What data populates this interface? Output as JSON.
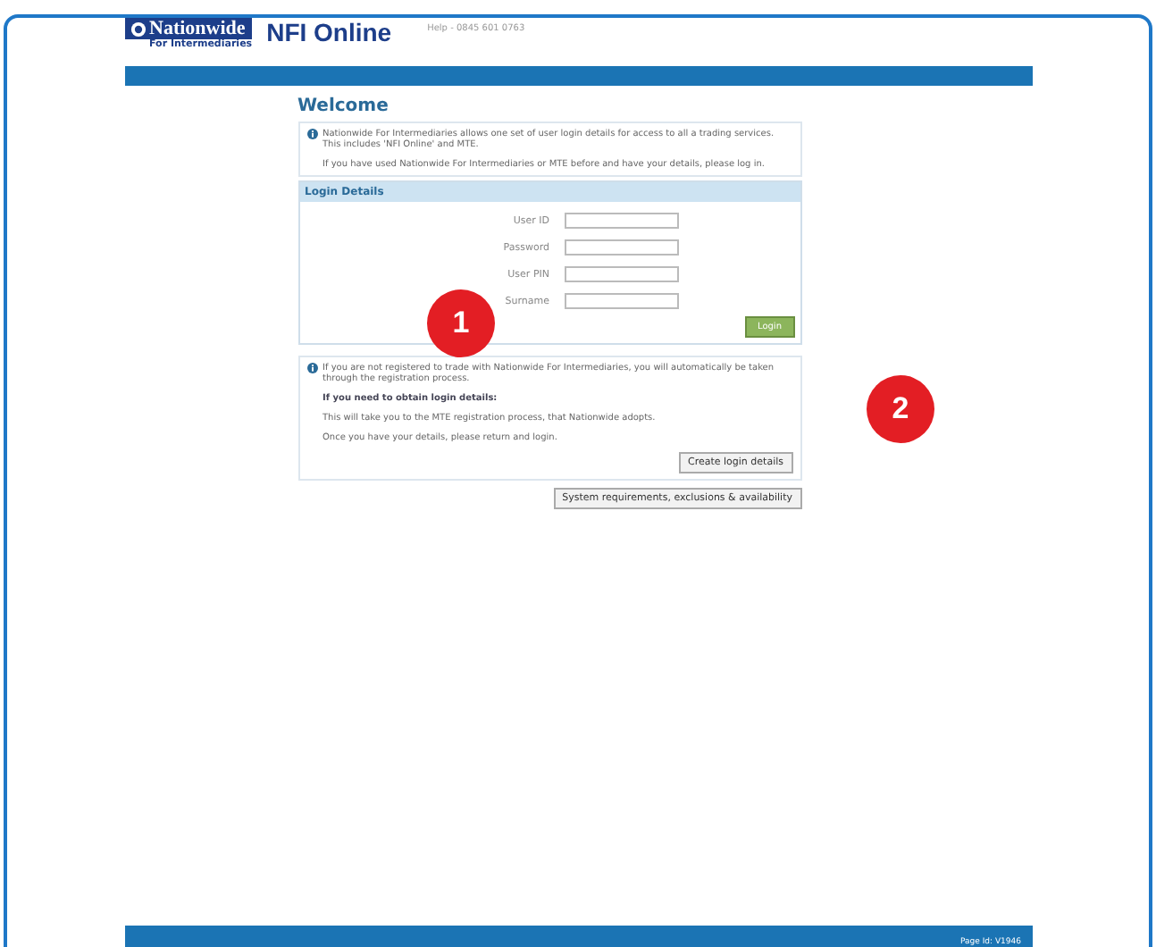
{
  "header": {
    "brand": "Nationwide",
    "brand_sub": "For Intermediaries",
    "title": "NFI Online",
    "help": "Help - 0845 601 0763"
  },
  "welcome": {
    "title": "Welcome",
    "info": [
      "Nationwide For Intermediaries allows one set of user login details for access to all a trading services. This includes 'NFI Online' and MTE.",
      "If you have used Nationwide For Intermediaries or MTE before and have your details, please log in."
    ]
  },
  "login": {
    "title": "Login Details",
    "fields": [
      {
        "label": "User ID"
      },
      {
        "label": "Password"
      },
      {
        "label": "User PIN"
      },
      {
        "label": "Surname"
      }
    ],
    "button": "Login"
  },
  "register": {
    "info": "If you are not registered to trade with Nationwide For Intermediaries, you will automatically be taken through the registration process.",
    "heading": "If you need to obtain login details:",
    "lines": [
      "This will take you to the MTE registration process, that Nationwide adopts.",
      "Once you have your details, please return and login."
    ],
    "button": "Create login details"
  },
  "system_button": "System requirements, exclusions & availability",
  "footer": {
    "page_id": "Page Id: V1946"
  },
  "annotations": [
    {
      "label": "1"
    },
    {
      "label": "2"
    }
  ]
}
